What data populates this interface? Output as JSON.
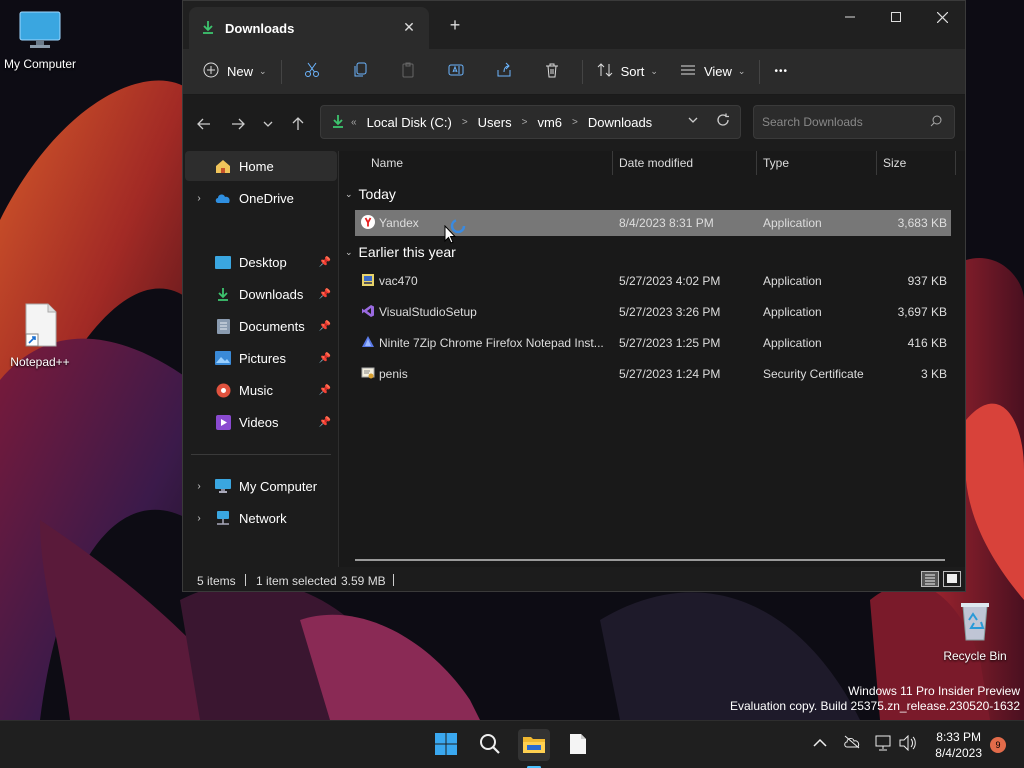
{
  "desktop": {
    "icons": [
      {
        "label": "My Computer"
      },
      {
        "label": "Notepad++"
      },
      {
        "label": "Recycle Bin"
      }
    ],
    "watermark_line1": "Windows 11 Pro Insider Preview",
    "watermark_line2": "Evaluation copy. Build 25375.zn_release.230520-1632"
  },
  "window": {
    "tab_title": "Downloads",
    "new_tab_glyph": "+",
    "toolbar": {
      "new_label": "New",
      "sort_label": "Sort",
      "view_label": "View",
      "more_glyph": "•••"
    },
    "address": {
      "overflow": "«",
      "crumbs": [
        "Local Disk (C:)",
        "Users",
        "vm6",
        "Downloads"
      ]
    },
    "search_placeholder": "Search Downloads",
    "nav": {
      "home": "Home",
      "onedrive": "OneDrive",
      "desktop": "Desktop",
      "downloads": "Downloads",
      "documents": "Documents",
      "pictures": "Pictures",
      "music": "Music",
      "videos": "Videos",
      "mycomputer": "My Computer",
      "network": "Network"
    },
    "columns": {
      "name": "Name",
      "date": "Date modified",
      "type": "Type",
      "size": "Size"
    },
    "groups": {
      "today": "Today",
      "earlier": "Earlier this year"
    },
    "files": [
      {
        "name": "Yandex",
        "date": "8/4/2023 8:31 PM",
        "type": "Application",
        "size": "3,683 KB",
        "icon": "yandex-icon"
      },
      {
        "name": "vac470",
        "date": "5/27/2023 4:02 PM",
        "type": "Application",
        "size": "937 KB",
        "icon": "installer-icon"
      },
      {
        "name": "VisualStudioSetup",
        "date": "5/27/2023 3:26 PM",
        "type": "Application",
        "size": "3,697 KB",
        "icon": "visual-studio-icon"
      },
      {
        "name": "Ninite 7Zip Chrome Firefox Notepad Inst...",
        "date": "5/27/2023 1:25 PM",
        "type": "Application",
        "size": "416 KB",
        "icon": "ninite-icon"
      },
      {
        "name": "penis",
        "date": "5/27/2023 1:24 PM",
        "type": "Security Certificate",
        "size": "3 KB",
        "icon": "certificate-icon"
      }
    ],
    "status": {
      "count": "5 items",
      "selected": "1 item selected",
      "selected_size": "3.59 MB"
    }
  },
  "taskbar": {
    "time": "8:33 PM",
    "date": "8/4/2023",
    "notification_count": "9"
  },
  "colors": {
    "accent": "#4cc2ff",
    "selection": "#777777",
    "window_bg": "#1c1c1c",
    "taskbar_bg": "#1f1f1f"
  }
}
